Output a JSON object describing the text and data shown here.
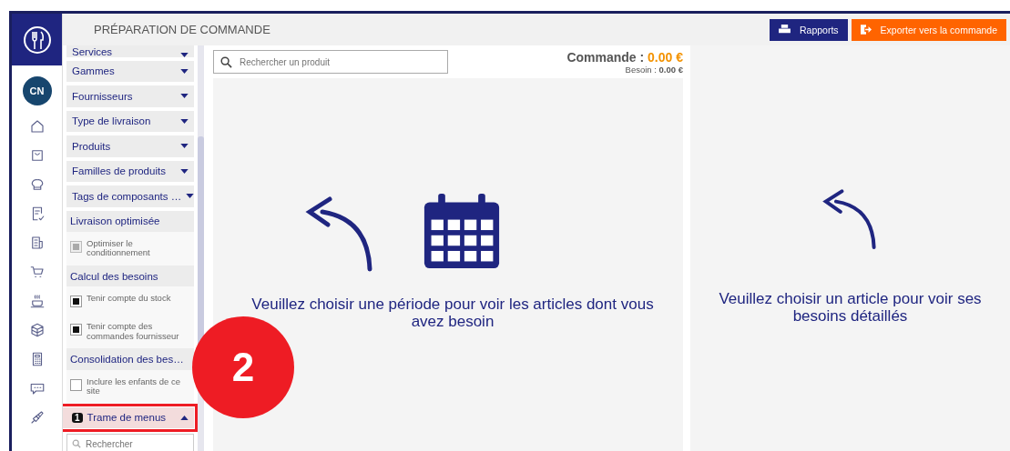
{
  "header": {
    "title": "PRÉPARATION DE COMMANDE",
    "buttons": [
      {
        "label": "Rapports",
        "kind": "reports"
      },
      {
        "label": "Exporter vers la commande",
        "kind": "export"
      }
    ]
  },
  "avatar": {
    "initials": "CN"
  },
  "filters": [
    {
      "kind": "dropdown",
      "label": "Services",
      "expanded": false
    },
    {
      "kind": "dropdown",
      "label": "Gammes",
      "expanded": false
    },
    {
      "kind": "dropdown",
      "label": "Fournisseurs",
      "expanded": false
    },
    {
      "kind": "dropdown",
      "label": "Type de livraison",
      "expanded": false
    },
    {
      "kind": "dropdown",
      "label": "Produits",
      "expanded": false
    },
    {
      "kind": "dropdown",
      "label": "Familles de produits",
      "expanded": false
    },
    {
      "kind": "dropdown",
      "label": "Tags de composants …",
      "expanded": false
    },
    {
      "kind": "section",
      "label": "Livraison optimisée"
    },
    {
      "kind": "checkbox",
      "label": "Optimiser le conditionnement",
      "checked": true,
      "disabled": true
    },
    {
      "kind": "section",
      "label": "Calcul des besoins"
    },
    {
      "kind": "checkbox",
      "label": "Tenir compte du stock",
      "checked": true,
      "disabled": false
    },
    {
      "kind": "checkbox",
      "label": "Tenir compte des commandes fournisseur",
      "checked": true,
      "disabled": false
    },
    {
      "kind": "section",
      "label": "Consolidation des bes…"
    },
    {
      "kind": "checkbox",
      "label": "Inclure les enfants de ce site",
      "checked": false,
      "disabled": false
    },
    {
      "kind": "dropdown",
      "label": "Trame de menus",
      "expanded": true,
      "badge": "1",
      "highlighted": true
    },
    {
      "kind": "search",
      "placeholder": "Rechercher"
    }
  ],
  "search": {
    "placeholder": "Rechercher un produit"
  },
  "totals": {
    "order_label": "Commande :",
    "order_value": "0.00 €",
    "need_label": "Besoin :",
    "need_value": "0.00 €"
  },
  "center_message": "Veuillez choisir une période pour voir les articles dont vous avez besoin",
  "right_message": "Veuillez choisir un article pour voir ses besoins détaillés",
  "annotation": {
    "number": "2"
  }
}
